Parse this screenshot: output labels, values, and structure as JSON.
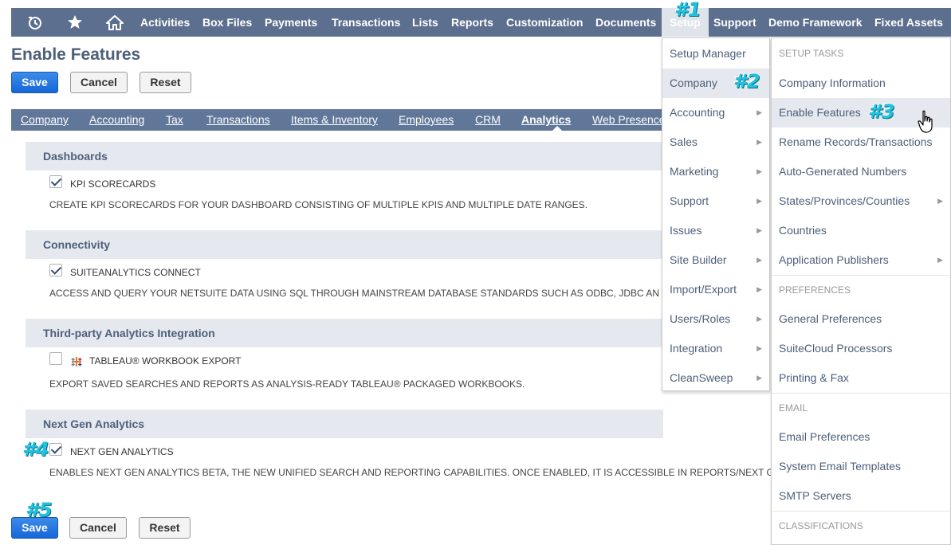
{
  "topnav": {
    "items": [
      "Activities",
      "Box Files",
      "Payments",
      "Transactions",
      "Lists",
      "Reports",
      "Customization",
      "Documents",
      "Setup",
      "Support",
      "Demo Framework",
      "Fixed Assets"
    ],
    "icons": [
      "recent-records-icon",
      "star-icon",
      "home-icon"
    ]
  },
  "page": {
    "title": "Enable Features",
    "buttons": {
      "save": "Save",
      "cancel": "Cancel",
      "reset": "Reset"
    }
  },
  "subtabs": {
    "items": [
      "Company",
      "Accounting",
      "Tax",
      "Transactions",
      "Items & Inventory",
      "Employees",
      "CRM",
      "Analytics",
      "Web Presence"
    ],
    "active": "Analytics"
  },
  "sections": [
    {
      "title": "Dashboards",
      "feature": "KPI SCORECARDS",
      "checked": true,
      "description": "CREATE KPI SCORECARDS FOR YOUR DASHBOARD CONSISTING OF MULTIPLE KPIS AND MULTIPLE DATE RANGES."
    },
    {
      "title": "Connectivity",
      "feature": "SUITEANALYTICS CONNECT",
      "checked": true,
      "description": "ACCESS AND QUERY YOUR NETSUITE DATA USING SQL THROUGH MAINSTREAM DATABASE STANDARDS SUCH AS ODBC, JDBC AN"
    },
    {
      "title": "Third-party Analytics Integration",
      "feature": "TABLEAU® WORKBOOK EXPORT",
      "checked": false,
      "description": "EXPORT SAVED SEARCHES AND REPORTS AS ANALYSIS-READY TABLEAU® PACKAGED WORKBOOKS."
    },
    {
      "title": "Next Gen Analytics",
      "feature": "NEXT GEN ANALYTICS",
      "checked": true,
      "description": "ENABLES NEXT GEN ANALYTICS BETA, THE NEW UNIFIED SEARCH AND REPORTING CAPABILITIES. ONCE ENABLED, IT IS ACCESSIBLE IN REPORTS/NEXT G"
    }
  ],
  "setup_menu": {
    "items": [
      "Setup Manager",
      "Company",
      "Accounting",
      "Sales",
      "Marketing",
      "Support",
      "Issues",
      "Site Builder",
      "Import/Export",
      "Users/Roles",
      "Integration",
      "CleanSweep"
    ],
    "highlighted": "Company"
  },
  "company_menu": {
    "headers": [
      "SETUP TASKS",
      "PREFERENCES",
      "EMAIL",
      "CLASSIFICATIONS"
    ],
    "setup_tasks": [
      "Company Information",
      "Enable Features",
      "Rename Records/Transactions",
      "Auto-Generated Numbers",
      "States/Provinces/Counties",
      "Countries",
      "Application Publishers"
    ],
    "preferences": [
      "General Preferences",
      "SuiteCloud Processors",
      "Printing & Fax"
    ],
    "email": [
      "Email Preferences",
      "System Email Templates",
      "SMTP Servers"
    ],
    "highlighted": "Enable Features"
  },
  "annotations": [
    "#1",
    "#2",
    "#3",
    "#4",
    "#5"
  ],
  "colors": {
    "nav": "#5d6f8f",
    "subtab": "#607799",
    "section": "#e5e9ef",
    "primary": "#1667d9",
    "annotation": "#22c2e0"
  }
}
